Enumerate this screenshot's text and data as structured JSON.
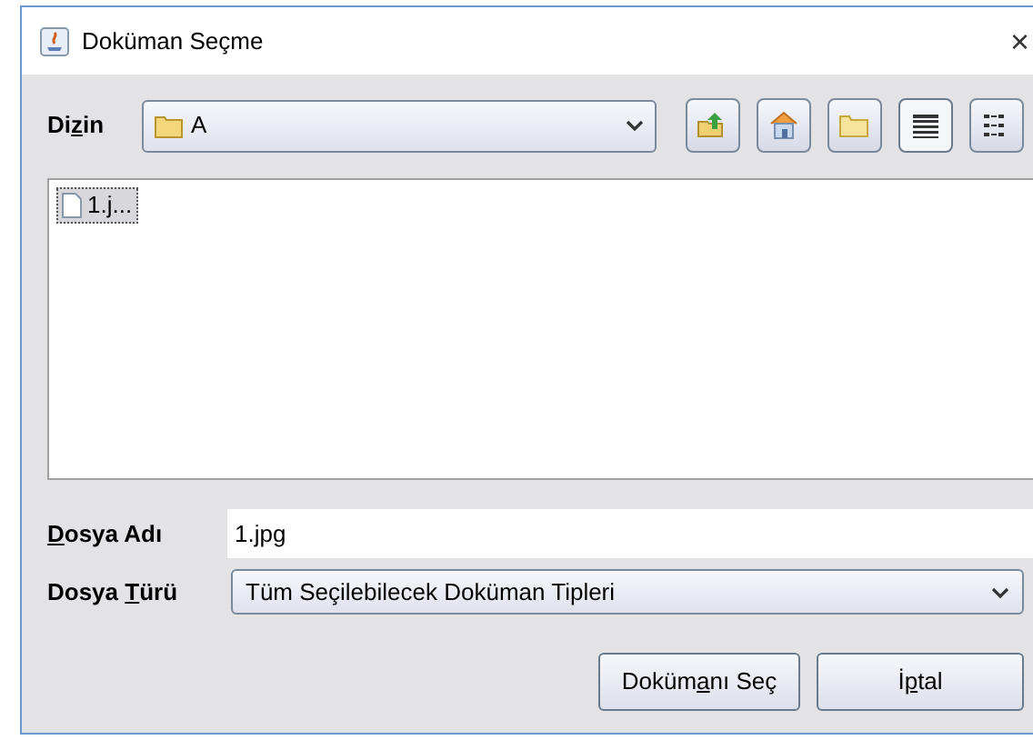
{
  "window": {
    "title": "Doküman Seçme",
    "close": "×"
  },
  "directory": {
    "label": {
      "before": "Di",
      "key": "z",
      "after": "in"
    },
    "value": "A"
  },
  "toolbar": [
    {
      "kind": "up",
      "selected": false
    },
    {
      "kind": "home",
      "selected": false
    },
    {
      "kind": "new-folder",
      "selected": false
    },
    {
      "kind": "list-view",
      "selected": true
    },
    {
      "kind": "details-view",
      "selected": false
    }
  ],
  "files": [
    {
      "name": "1.j...",
      "selected": true
    }
  ],
  "file_name": {
    "label": {
      "key": "D",
      "after": "osya Adı"
    },
    "value": "1.jpg"
  },
  "file_type": {
    "label": {
      "before": "Dosya ",
      "key": "T",
      "after": "ürü"
    },
    "value": "Tüm Seçilebilecek Doküman Tipleri"
  },
  "buttons": [
    {
      "label": {
        "before": "Doküm",
        "key": "a",
        "after": "nı Seç"
      }
    },
    {
      "label": {
        "before": "İ",
        "key": "p",
        "after": "tal"
      }
    }
  ]
}
